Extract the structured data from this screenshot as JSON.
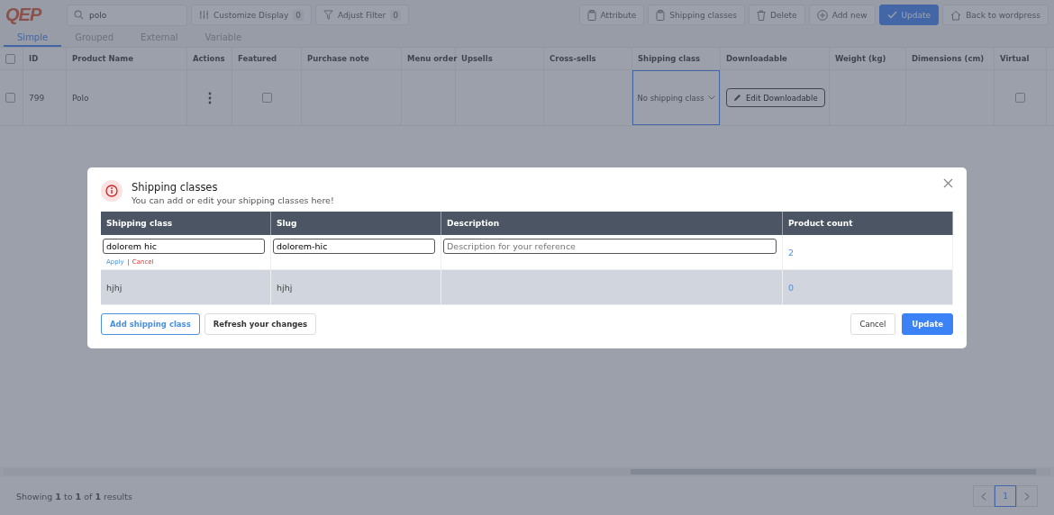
{
  "logo": "QEP",
  "search": {
    "value": "polo"
  },
  "filters": [
    {
      "kind": "customize",
      "label": "Customize Display",
      "count": "0"
    },
    {
      "kind": "filter",
      "label": "Adjust Filter",
      "count": "0"
    }
  ],
  "actions": [
    {
      "kind": "attribute",
      "label": "Attribute"
    },
    {
      "kind": "shipping",
      "label": "Shipping classes"
    },
    {
      "kind": "delete",
      "label": "Delete"
    },
    {
      "kind": "add",
      "label": "Add new"
    },
    {
      "kind": "update",
      "label": "Update"
    },
    {
      "kind": "home",
      "label": "Back to wordpress"
    }
  ],
  "tabs": [
    {
      "label": "Simple",
      "selected": true
    },
    {
      "label": "Grouped",
      "selected": false
    },
    {
      "label": "External",
      "selected": false
    },
    {
      "label": "Variable",
      "selected": false
    }
  ],
  "table": {
    "all_checked": false,
    "columns": [
      "ID",
      "Product Name",
      "Actions",
      "Featured",
      "Purchase note",
      "Menu order",
      "Upsells",
      "Cross-sells",
      "Shipping class",
      "Downloadable",
      "Weight (kg)",
      "Dimensions (cm)",
      "Virtual"
    ],
    "rows": [
      {
        "checked": false,
        "id": "799",
        "name": "Polo",
        "featured": false,
        "shipping_class": "No shipping class",
        "downloadable": "Edit Downloadable",
        "virtual": false
      }
    ]
  },
  "footer": {
    "summary": "Showing **1** to **1** of **1** results",
    "pages": [
      {
        "label": "1",
        "selected": true
      }
    ]
  },
  "modal": {
    "title": "Shipping classes",
    "subtitle": "You can add or edit your shipping classes here!",
    "columns": [
      "Shipping class",
      "Slug",
      "Description",
      "Product count"
    ],
    "rows": [
      {
        "kind": "edit",
        "selected": false,
        "shipping_class": "dolorem hic",
        "slug": "dolorem-hic",
        "description_placeholder": "Description for your reference",
        "apply": "Apply",
        "cancel": "Cancel",
        "product_count": "2"
      },
      {
        "kind": "view",
        "selected": true,
        "shipping_class": "hjhj",
        "slug": "hjhj",
        "product_count": "0"
      }
    ],
    "left_buttons": [
      "Add shipping class",
      "Refresh your changes"
    ],
    "cancel": "Cancel",
    "update": "Update"
  }
}
